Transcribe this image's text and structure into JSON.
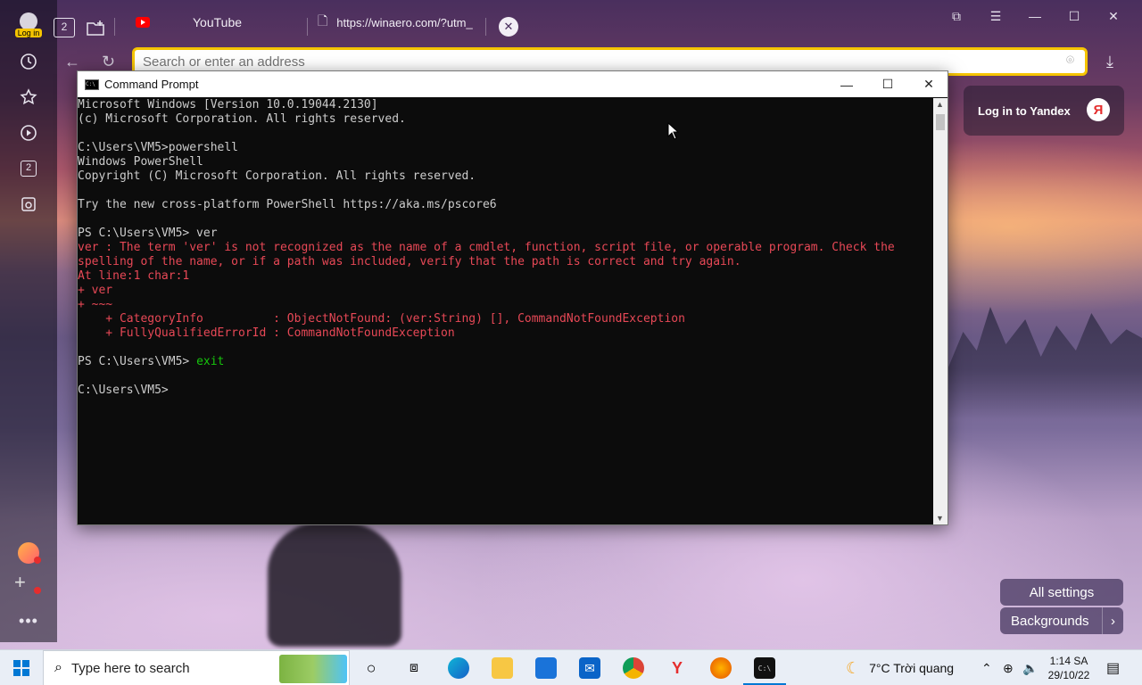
{
  "browser": {
    "login_label": "Log in",
    "tab_count": "2",
    "tabs": [
      {
        "label": "YouTube"
      },
      {
        "label": "https://winaero.com/?utm_"
      }
    ],
    "address_placeholder": "Search or enter an address",
    "yandex_login": "Log in to Yandex",
    "yandex_logo": "Я",
    "all_settings": "All settings",
    "backgrounds": "Backgrounds",
    "sidebar_badge": "2"
  },
  "cmd": {
    "title": "Command Prompt",
    "lines": [
      {
        "text": "Microsoft Windows [Version 10.0.19044.2130]",
        "style": "normal"
      },
      {
        "text": "(c) Microsoft Corporation. All rights reserved.",
        "style": "normal"
      },
      {
        "text": "",
        "style": "normal"
      },
      {
        "text": "C:\\Users\\VM5>powershell",
        "style": "normal"
      },
      {
        "text": "Windows PowerShell",
        "style": "normal"
      },
      {
        "text": "Copyright (C) Microsoft Corporation. All rights reserved.",
        "style": "normal"
      },
      {
        "text": "",
        "style": "normal"
      },
      {
        "text": "Try the new cross-platform PowerShell https://aka.ms/pscore6",
        "style": "normal"
      },
      {
        "text": "",
        "style": "normal"
      },
      {
        "text": "PS C:\\Users\\VM5> ver",
        "style": "normal"
      },
      {
        "text": "ver : The term 'ver' is not recognized as the name of a cmdlet, function, script file, or operable program. Check the",
        "style": "err"
      },
      {
        "text": "spelling of the name, or if a path was included, verify that the path is correct and try again.",
        "style": "err"
      },
      {
        "text": "At line:1 char:1",
        "style": "err"
      },
      {
        "text": "+ ver",
        "style": "err"
      },
      {
        "text": "+ ~~~",
        "style": "err"
      },
      {
        "text": "    + CategoryInfo          : ObjectNotFound: (ver:String) [], CommandNotFoundException",
        "style": "err"
      },
      {
        "text": "    + FullyQualifiedErrorId : CommandNotFoundException",
        "style": "err"
      },
      {
        "text": "",
        "style": "normal"
      },
      {
        "text": "PS C:\\Users\\VM5> ",
        "style": "normal",
        "cmd": "exit"
      },
      {
        "text": "",
        "style": "normal"
      },
      {
        "text": "C:\\Users\\VM5>",
        "style": "normal"
      }
    ]
  },
  "taskbar": {
    "search_placeholder": "Type here to search",
    "weather": "7°C  Trời quang",
    "time": "1:14 SA",
    "date": "29/10/22"
  },
  "colors": {
    "accent_yellow": "#f5c400",
    "console_bg": "#0c0c0c",
    "console_error": "#e74856",
    "console_green": "#16c60c"
  }
}
